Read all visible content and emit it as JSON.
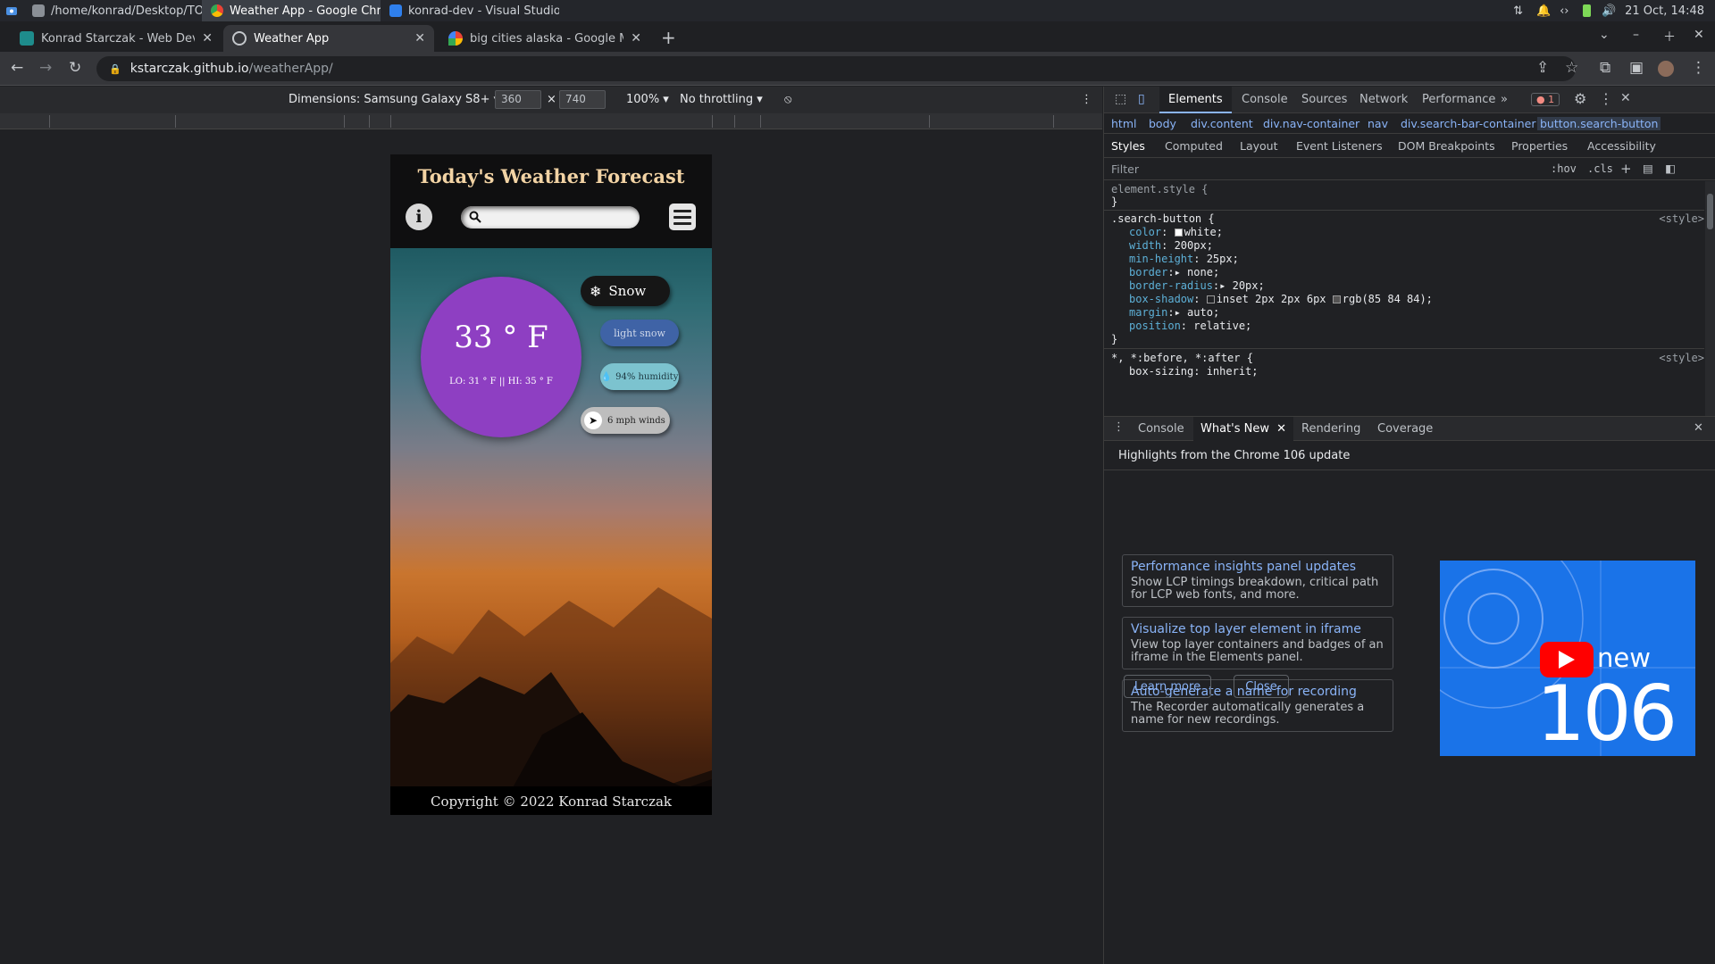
{
  "taskbar": {
    "windows": [
      {
        "label": "/home/konrad/Desktop/TOP..."
      },
      {
        "label": "Weather App - Google Chro..."
      },
      {
        "label": "konrad-dev - Visual Studio C..."
      }
    ],
    "clock": "21 Oct, 14:48"
  },
  "browser": {
    "tabs": [
      {
        "label": "Konrad Starczak - Web Develop"
      },
      {
        "label": "Weather App"
      },
      {
        "label": "big cities alaska - Google Maps"
      }
    ],
    "url_host": "kstarczak.github.io",
    "url_path": "/weatherApp/"
  },
  "device_toolbar": {
    "dimensions_label": "Dimensions: Samsung Galaxy S8+",
    "width": "360",
    "height": "740",
    "zoom": "100%",
    "throttling": "No throttling"
  },
  "app": {
    "title": "Today's Weather Forecast",
    "info_icon": "i",
    "temperature": "33 ° F",
    "range": "LO: 31 ° F || HI: 35 ° F",
    "condition": "Snow",
    "description": "light snow",
    "humidity": "94% humidity",
    "wind": "6 mph winds",
    "copyright": "Copyright © 2022 Konrad Starczak",
    "colors": {
      "circle": "#8e3fc2",
      "title": "#f2d3a4"
    }
  },
  "devtools": {
    "tabs": [
      "Elements",
      "Console",
      "Sources",
      "Network",
      "Performance",
      "»"
    ],
    "error_count": "1",
    "breadcrumbs": [
      "html",
      "body",
      "div.content",
      "div.nav-container",
      "nav",
      "div.search-bar-container",
      "button.search-button"
    ],
    "subtabs": [
      "Styles",
      "Computed",
      "Layout",
      "Event Listeners",
      "DOM Breakpoints",
      "Properties",
      "Accessibility"
    ],
    "filter_placeholder": "Filter",
    "hov": ":hov",
    "cls": ".cls",
    "styles": {
      "element_style": "element.style {",
      "close_brace": "}",
      "rule_selector": ".search-button {",
      "rule_source": "<style>",
      "props": [
        {
          "name": "color",
          "value": "white;"
        },
        {
          "name": "width",
          "value": "200px;"
        },
        {
          "name": "min-height",
          "value": "25px;"
        },
        {
          "name": "border",
          "value": "none;"
        },
        {
          "name": "border-radius",
          "value": "20px;"
        },
        {
          "name": "box-shadow",
          "value": "inset 2px 2px 6px",
          "value2": "rgb(85 84 84);"
        },
        {
          "name": "margin",
          "value": "auto;"
        },
        {
          "name": "position",
          "value": "relative;"
        }
      ],
      "rule2_selector": "*, *:before, *:after {",
      "rule2_source": "<style>",
      "rule2_first": "box-sizing: inherit;"
    },
    "drawer_tabs": [
      "Console",
      "What's New",
      "Rendering",
      "Coverage"
    ],
    "whatsnew": {
      "heading": "Highlights from the Chrome 106 update",
      "cards": [
        {
          "title": "Performance insights panel updates",
          "desc": "Show LCP timings breakdown, critical path for LCP web fonts, and more."
        },
        {
          "title": "Visualize top layer element in iframe",
          "desc": "View top layer containers and badges of an iframe in the Elements panel."
        },
        {
          "title": "Auto-generate a name for recording",
          "desc": "The Recorder automatically generates a name for new recordings."
        }
      ],
      "learn_more": "Learn more",
      "close": "Close",
      "promo_new": "new",
      "promo_version": "106"
    }
  }
}
